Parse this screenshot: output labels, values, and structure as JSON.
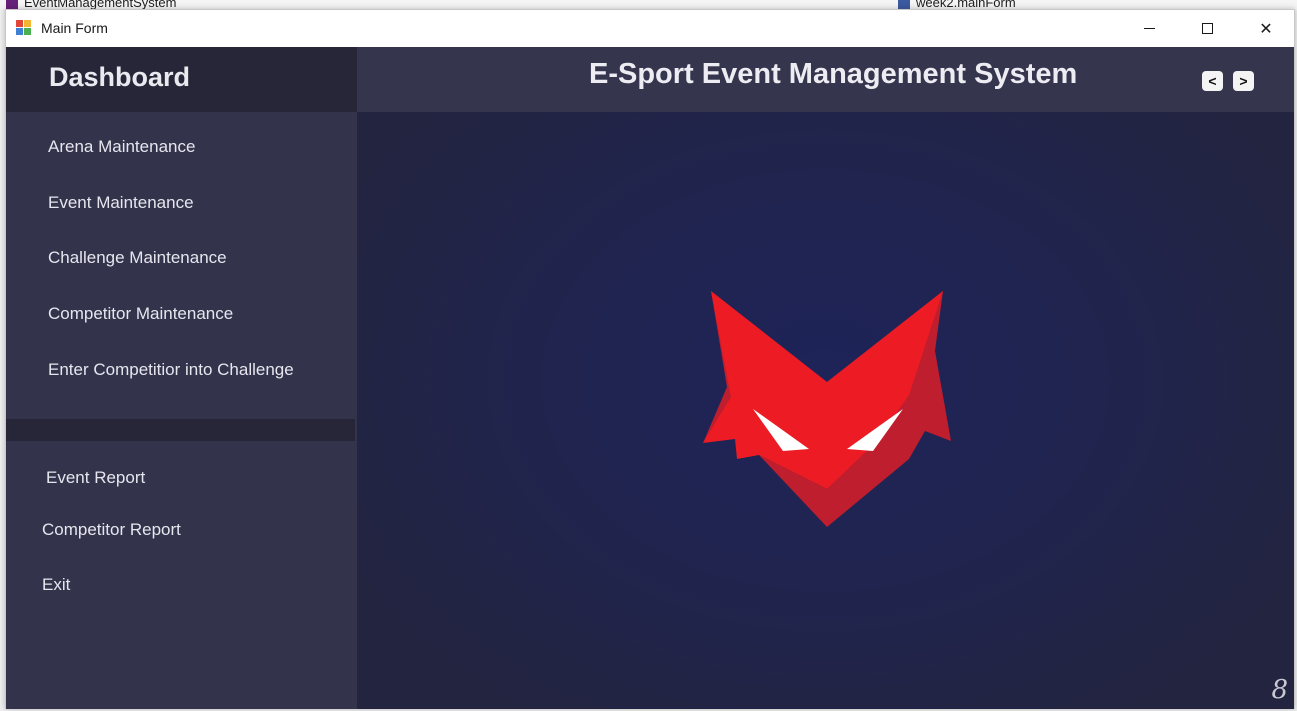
{
  "ide": {
    "left_project": "EventManagementSystem",
    "right_file": "week2.mainForm"
  },
  "window": {
    "title": "Main Form",
    "app_icon": "winforms-app-icon",
    "controls": {
      "minimize_icon": "minimize-icon",
      "maximize_icon": "maximize-icon",
      "close_icon": "close-icon",
      "close_glyph": "✕"
    }
  },
  "sidebar": {
    "title": "Dashboard",
    "maintenance_items": [
      {
        "label": "Arena Maintenance"
      },
      {
        "label": "Event Maintenance"
      },
      {
        "label": "Challenge Maintenance"
      },
      {
        "label": "Competitor Maintenance"
      },
      {
        "label": "Enter Competitior into Challenge"
      }
    ],
    "report_items": [
      {
        "label": "Event Report"
      },
      {
        "label": "Competitor Report"
      },
      {
        "label": "Exit"
      }
    ]
  },
  "header": {
    "title": "E-Sport Event Management System",
    "prev_label": "<",
    "next_label": ">"
  },
  "main": {
    "logo_icon": "red-fox-logo-icon",
    "grip_glyph": "8"
  },
  "colors": {
    "sidebar_bg": "#33334c",
    "header_bg": "#262638",
    "content_bg": "#1e2359",
    "logo_red": "#ed1c24",
    "logo_dark_red": "#be1e2d"
  }
}
